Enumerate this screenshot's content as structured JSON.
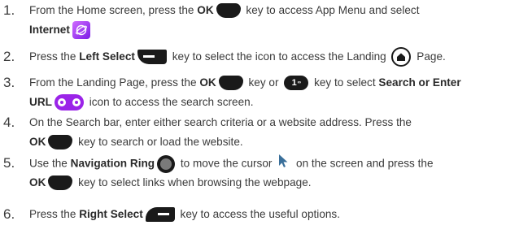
{
  "steps": [
    {
      "number": "1.",
      "line1_a": "From the Home screen, press the ",
      "line1_ok": "OK",
      "line1_b": " key to access App Menu and select",
      "line2_bold": "Internet"
    },
    {
      "number": "2.",
      "a": "Press the ",
      "bold": "Left Select",
      "b": " key to select the icon to access the Landing ",
      "c": " Page."
    },
    {
      "number": "3.",
      "line1_a": "From the Landing Page, press the ",
      "line1_ok": "OK",
      "line1_b": " key or ",
      "key1_label": "1",
      "key1_sub": "∞",
      "line1_c": " key to select ",
      "line1_bold": "Search or  Enter",
      "line2_bold": "URL",
      "line2_b": " icon to access the search screen."
    },
    {
      "number": "4.",
      "line1": "On the Search bar, enter either search criteria or a website address. Press the",
      "line2_ok": "OK",
      "line2_b": " key to search or load the website."
    },
    {
      "number": "5.",
      "line1_a": "Use the ",
      "line1_bold": "Navigation Ring",
      "line1_b": " to move the cursor ",
      "line1_c": " on the screen and press the",
      "line2_ok": "OK",
      "line2_b": " key to select links when browsing the webpage."
    },
    {
      "number": "6.",
      "a": "Press the ",
      "bold": "Right Select",
      "b": " key to access the useful options."
    }
  ],
  "colors": {
    "text": "#3a3a3a",
    "key": "#1a1a1a",
    "accent_purple": "#9b24e8"
  }
}
